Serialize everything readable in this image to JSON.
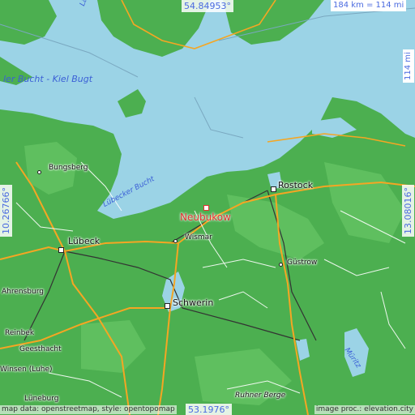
{
  "colors": {
    "sea": "#9bd3e6",
    "land": "#4caf50",
    "highland": "#5fbf5f",
    "road_major": "#f5a623",
    "road_minor": "#ffffff",
    "rail": "#333333",
    "marker": "#e0312f",
    "coord_text": "#4a6ae0"
  },
  "coords": {
    "top": "54.84953°",
    "bottom": "53.1976°",
    "left": "10.26766°",
    "right": "13.08016°"
  },
  "scale": {
    "horizontal": "184 km = 114 mi",
    "vertical": "114 mi"
  },
  "labels": {
    "langeland": "Lan",
    "kieler_bucht": "ler Bucht - Kiel Bugt",
    "luebecker_bucht": "Lübecker Bucht",
    "bungsberg": "Bungsberg",
    "luebeck": "Lübeck",
    "ahrensburg": "Ahrensburg",
    "reinbek": "Reinbek",
    "geesthacht": "Geesthacht",
    "winsen": "Winsen (Luhe)",
    "lueneburg": "Lüneburg",
    "neubukow": "Neubukow",
    "wismar": "Wismar",
    "schwerin": "Schwerin",
    "rostock": "Rostock",
    "guestrow": "Güstrow",
    "mueritz": "Müritz",
    "ruhner_berge": "Ruhner Berge"
  },
  "attribution": {
    "left": "map data: openstreetmap, style: opentopomap",
    "right": "image proc.: elevation.city"
  }
}
